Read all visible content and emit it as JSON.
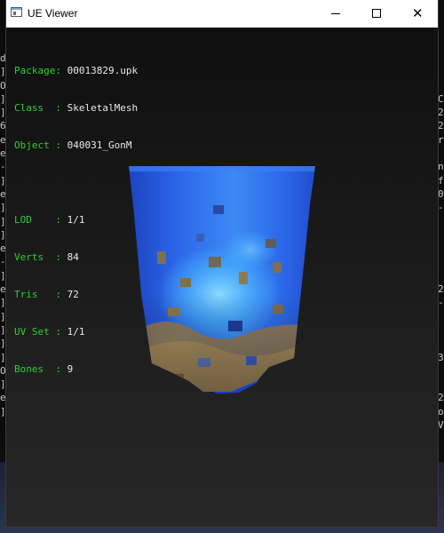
{
  "window": {
    "title": "UE Viewer"
  },
  "info": {
    "package": {
      "label": "Package",
      "value": "00013829.upk"
    },
    "class": {
      "label": "Class  ",
      "value": "SkeletalMesh"
    },
    "object": {
      "label": "Object ",
      "value": "040031_GonM"
    },
    "lod": {
      "label": "LOD    ",
      "value": "1/1"
    },
    "verts": {
      "label": "Verts  ",
      "value": "84"
    },
    "tris": {
      "label": "Tris   ",
      "value": "72"
    },
    "uvset": {
      "label": "UV Set ",
      "value": "1/1"
    },
    "bones": {
      "label": "Bones  ",
      "value": "9"
    },
    "separator": ": "
  },
  "background_console": {
    "left_chars": [
      "d",
      "]",
      "O",
      "]",
      "]",
      "6",
      "e",
      "e",
      "-",
      "]",
      "e",
      "]",
      "]",
      "]",
      "e",
      "-",
      "]",
      "e",
      "]",
      "]",
      "]",
      "]",
      "]",
      "O",
      "]",
      "e",
      "]"
    ],
    "right_chars": [
      "",
      "",
      "",
      "C",
      "2",
      "2",
      "r",
      "",
      "n",
      "f",
      "0",
      "-",
      "",
      "",
      "",
      "",
      "",
      "2",
      "-",
      "",
      "",
      "",
      "3",
      "",
      "",
      "2",
      "o",
      "V"
    ]
  },
  "colors": {
    "label_green": "#2fd02f",
    "value_white": "#e8e8e8",
    "viewport_bg": "#151515",
    "mesh_blue": "#1f5ae0",
    "mesh_cyan": "#46b4ff",
    "mesh_tan": "#a88a55"
  },
  "icons": {
    "app": "window-app-icon",
    "minimize": "minimize-icon",
    "maximize": "maximize-icon",
    "close": "close-icon"
  }
}
